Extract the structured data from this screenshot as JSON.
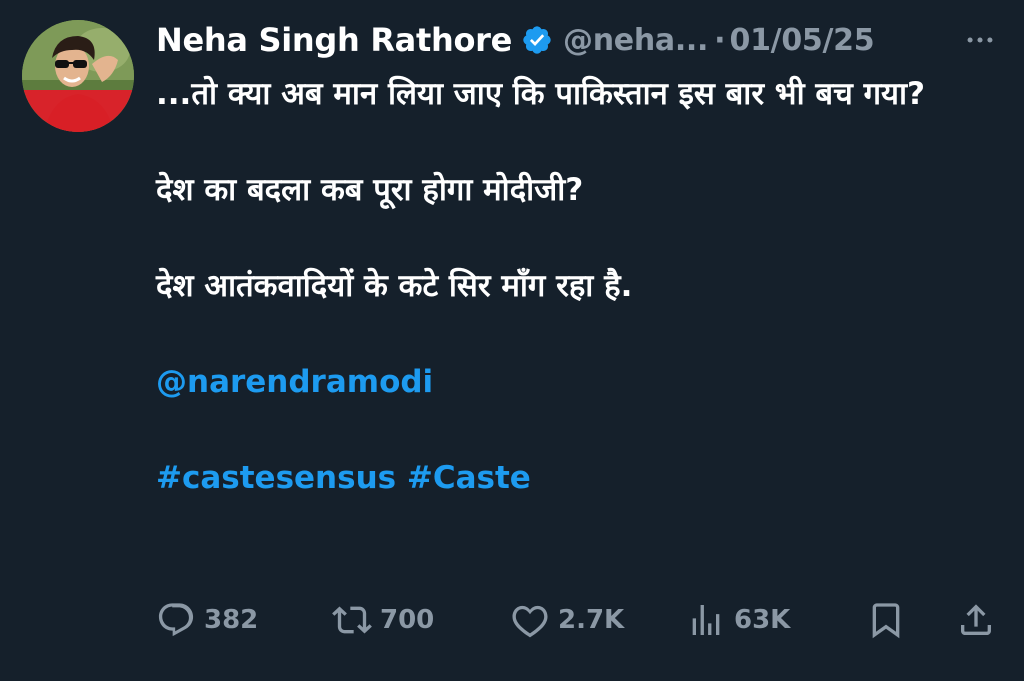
{
  "tweet": {
    "author_name": "Neha Singh Rathore",
    "handle": "@neha...",
    "separator": "·",
    "date": "01/05/25",
    "body": {
      "line1": "...तो क्या अब मान लिया जाए कि पाकिस्तान इस बार भी बच गया?",
      "line2": "देश का बदला कब पूरा होगा मोदीजी?",
      "line3": "देश आतंकवादियों के कटे सिर माँग रहा है.",
      "mention": "@narendramodi",
      "hashtag1": "#castesensus",
      "hashtag2": "#Caste"
    }
  },
  "actions": {
    "replies": "382",
    "retweets": "700",
    "likes": "2.7K",
    "views": "63K"
  },
  "icons": {
    "verified": "verified-badge-icon",
    "more": "more-dots-icon",
    "reply": "reply-icon",
    "retweet": "retweet-icon",
    "like": "heart-icon",
    "views": "views-icon",
    "bookmark": "bookmark-icon",
    "share": "share-icon"
  },
  "colors": {
    "background": "#15202b",
    "text": "#ffffff",
    "muted": "#8b98a5",
    "accent": "#1d9bf0"
  }
}
